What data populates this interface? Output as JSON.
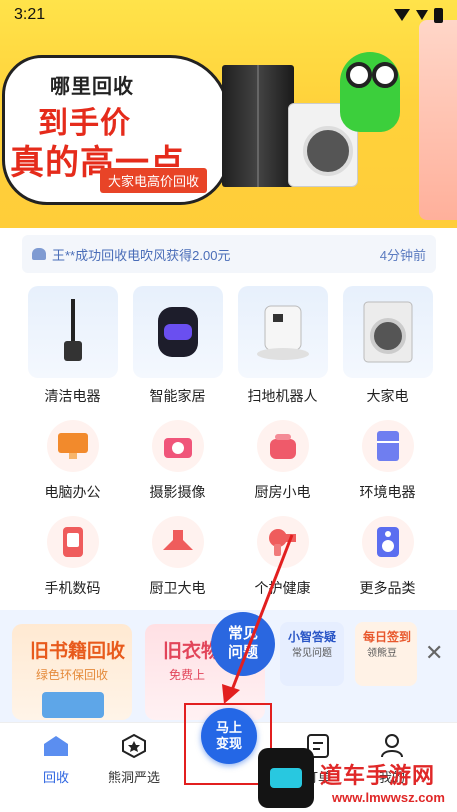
{
  "status_bar": {
    "time": "3:21"
  },
  "banner": {
    "title": "哪里回收",
    "headline_1": "到手价",
    "headline_2": "真的高一点",
    "chip": "大家电高价回收"
  },
  "notice": {
    "text": "王**成功回收电吹风获得2.00元",
    "time": "4分钟前"
  },
  "categories": [
    {
      "label": "清洁电器",
      "icon": "vacuum-icon"
    },
    {
      "label": "智能家居",
      "icon": "smart-speaker-icon"
    },
    {
      "label": "扫地机器人",
      "icon": "robot-vacuum-icon"
    },
    {
      "label": "大家电",
      "icon": "washing-machine-icon"
    },
    {
      "label": "电脑办公",
      "icon": "monitor-icon"
    },
    {
      "label": "摄影摄像",
      "icon": "camera-icon"
    },
    {
      "label": "厨房小电",
      "icon": "rice-cooker-icon"
    },
    {
      "label": "环境电器",
      "icon": "fridge-icon"
    },
    {
      "label": "手机数码",
      "icon": "phone-icon"
    },
    {
      "label": "厨卫大电",
      "icon": "range-hood-icon"
    },
    {
      "label": "个护健康",
      "icon": "hair-dryer-icon"
    },
    {
      "label": "更多品类",
      "icon": "speaker-icon"
    }
  ],
  "promo": {
    "card1": {
      "title": "旧书籍回收",
      "subtitle": "绿色环保回收"
    },
    "card2": {
      "title": "旧衣物",
      "subtitle": "免费上"
    },
    "faq": {
      "line1": "常见",
      "line2": "问题"
    },
    "mini1": {
      "title": "小智答疑",
      "subtitle": "常见问题"
    },
    "mini2": {
      "title": "每日签到",
      "subtitle": "领熊豆"
    },
    "close": "✕"
  },
  "bottom_nav": {
    "home": "回收",
    "xd": "熊洞严选",
    "fab_line1": "马上",
    "fab_line2": "变现",
    "order": "订单",
    "mine": "我的"
  },
  "watermark": {
    "title": "道车手游网",
    "url": "www.lmwwsz.com"
  },
  "colors": {
    "brand_blue": "#2467e6",
    "highlight_red": "#e21f1f",
    "banner_yellow": "#ffd23b"
  }
}
